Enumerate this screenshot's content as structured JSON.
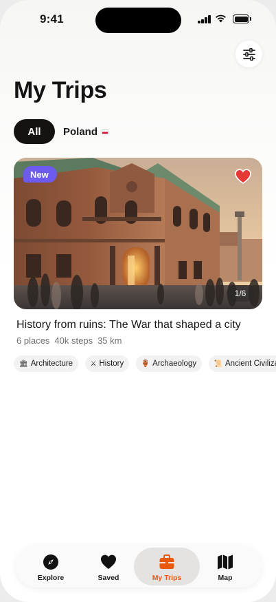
{
  "status_bar": {
    "time": "9:41"
  },
  "header": {
    "title": "My Trips"
  },
  "filters": {
    "all_label": "All",
    "country_label": "Poland",
    "country_flag_icon": "poland-flag-icon"
  },
  "trip": {
    "badge": "New",
    "photo_counter": "1/6",
    "title": "History from ruins: The War that shaped a city",
    "places": "6 places",
    "steps": "40k steps",
    "distance": "35 km",
    "favorited": true,
    "tags": [
      {
        "icon": "🏛",
        "label": "Architecture"
      },
      {
        "icon": "⚔",
        "label": "History"
      },
      {
        "icon": "🏺",
        "label": "Archaeology"
      },
      {
        "icon": "📜",
        "label": "Ancient Civilizations"
      }
    ]
  },
  "tab_bar": {
    "tabs": [
      {
        "label": "Explore",
        "icon": "compass-icon"
      },
      {
        "label": "Saved",
        "icon": "heart-icon"
      },
      {
        "label": "My Trips",
        "icon": "suitcase-icon"
      },
      {
        "label": "Map",
        "icon": "map-icon"
      }
    ],
    "active": "My Trips"
  },
  "colors": {
    "accent": "#e8590c",
    "badge": "#6d5bf0",
    "favorite": "#e53935",
    "chip_active": "#15130f"
  }
}
